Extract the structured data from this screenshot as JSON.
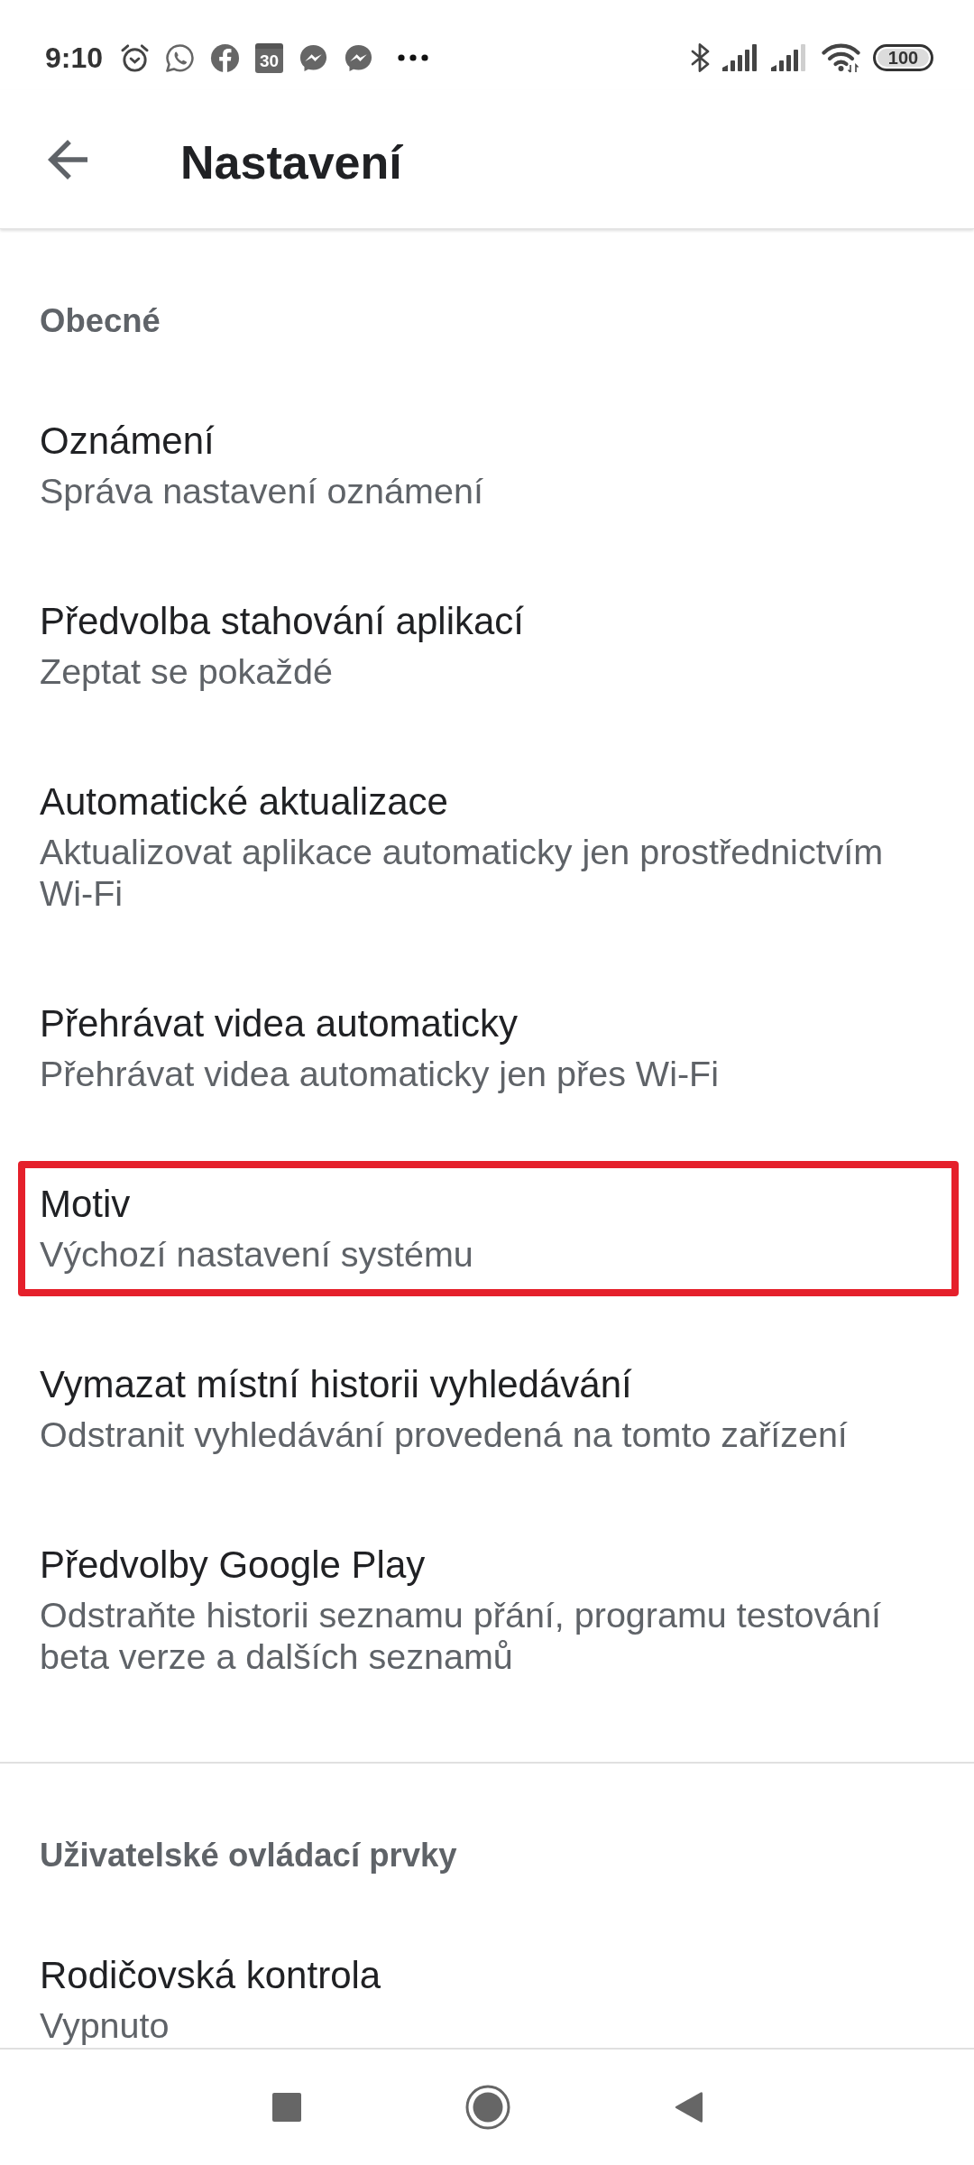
{
  "status_bar": {
    "time": "9:10",
    "calendar_day": "30",
    "battery": "100"
  },
  "app_bar": {
    "title": "Nastavení"
  },
  "sections": [
    {
      "header": "Obecné",
      "items": [
        {
          "title": "Oznámení",
          "subtitle": "Správa nastavení oznámení",
          "highlighted": false
        },
        {
          "title": "Předvolba stahování aplikací",
          "subtitle": "Zeptat se pokaždé",
          "highlighted": false
        },
        {
          "title": "Automatické aktualizace",
          "subtitle": "Aktualizovat aplikace automaticky jen prostřednictvím Wi-Fi",
          "highlighted": false
        },
        {
          "title": "Přehrávat videa automaticky",
          "subtitle": "Přehrávat videa automaticky jen přes Wi-Fi",
          "highlighted": false
        },
        {
          "title": "Motiv",
          "subtitle": "Výchozí nastavení systému",
          "highlighted": true
        },
        {
          "title": "Vymazat místní historii vyhledávání",
          "subtitle": "Odstranit vyhledávání provedená na tomto zařízení",
          "highlighted": false
        },
        {
          "title": "Předvolby Google Play",
          "subtitle": "Odstraňte historii seznamu přání, programu testování beta verze a dalších seznamů",
          "highlighted": false
        }
      ]
    },
    {
      "header": "Uživatelské ovládací prvky",
      "items": [
        {
          "title": "Rodičovská kontrola",
          "subtitle": "Vypnuto",
          "highlighted": false
        }
      ]
    }
  ]
}
